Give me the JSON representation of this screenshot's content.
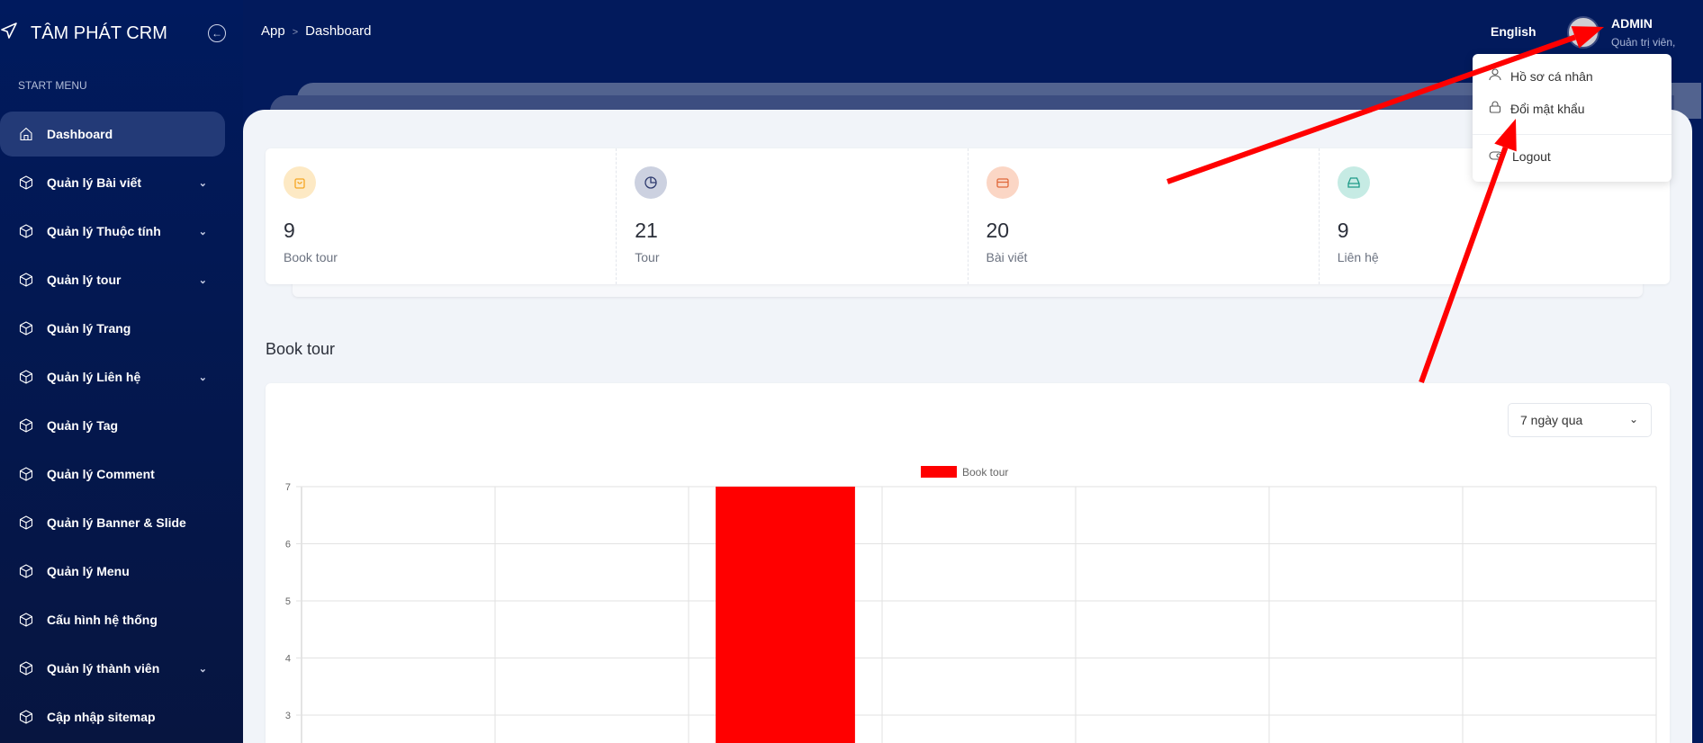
{
  "sidebar": {
    "brand": "TÂM PHÁT CRM",
    "section_label": "START MENU",
    "items": [
      {
        "label": "Dashboard",
        "icon": "home-icon",
        "active": true,
        "expandable": false
      },
      {
        "label": "Quản lý Bài viết",
        "icon": "cube-icon",
        "expandable": true
      },
      {
        "label": "Quản lý Thuộc tính",
        "icon": "cube-icon",
        "expandable": true
      },
      {
        "label": "Quản lý tour",
        "icon": "cube-icon",
        "expandable": true
      },
      {
        "label": "Quản lý Trang",
        "icon": "cube-icon",
        "expandable": false
      },
      {
        "label": "Quản lý Liên hệ",
        "icon": "cube-icon",
        "expandable": true
      },
      {
        "label": "Quản lý Tag",
        "icon": "cube-icon",
        "expandable": false
      },
      {
        "label": "Quản lý Comment",
        "icon": "cube-icon",
        "expandable": false
      },
      {
        "label": "Quản lý Banner & Slide",
        "icon": "cube-icon",
        "expandable": false
      },
      {
        "label": "Quản lý Menu",
        "icon": "cube-icon",
        "expandable": false
      },
      {
        "label": "Cấu hình hệ thống",
        "icon": "cube-icon",
        "expandable": false
      },
      {
        "label": "Quản lý thành viên",
        "icon": "cube-icon",
        "expandable": true
      },
      {
        "label": "Cập nhập sitemap",
        "icon": "cube-icon",
        "expandable": false
      }
    ]
  },
  "header": {
    "breadcrumb": [
      "App",
      "Dashboard"
    ],
    "language": "English",
    "user": {
      "name": "ADMIN",
      "role": "Quản trị viên,"
    }
  },
  "user_menu": {
    "items": [
      {
        "label": "Hồ sơ cá nhân",
        "icon": "user-icon"
      },
      {
        "label": "Đổi mật khẩu",
        "icon": "lock-icon"
      },
      {
        "label": "Logout",
        "icon": "toggle-icon"
      }
    ]
  },
  "stats": [
    {
      "value": "9",
      "label": "Book tour",
      "icon": "shopping-bag-icon",
      "color": "#f5a623",
      "bg": "#fde9c4"
    },
    {
      "value": "21",
      "label": "Tour",
      "icon": "pie-chart-icon",
      "color": "#2d3a6e",
      "bg": "#ccd1e0"
    },
    {
      "value": "20",
      "label": "Bài viết",
      "icon": "credit-card-icon",
      "color": "#e0683a",
      "bg": "#fbd6c5"
    },
    {
      "value": "9",
      "label": "Liên hệ",
      "icon": "inbox-icon",
      "color": "#1e9a87",
      "bg": "#c6ebe4"
    }
  ],
  "section_title": "Book tour",
  "range_select": {
    "value": "7 ngày qua"
  },
  "chart_data": {
    "type": "bar",
    "legend": [
      {
        "name": "Book tour",
        "color": "#ff0000"
      }
    ],
    "legend_position": "top",
    "categories_count": 7,
    "series": [
      {
        "name": "Book tour",
        "values": [
          0,
          0,
          7,
          0,
          0,
          0,
          0
        ]
      }
    ],
    "yticks": [
      3,
      4,
      5,
      6,
      7
    ],
    "ylim": [
      0,
      7
    ],
    "grid": true
  },
  "annotation_color": "#ff0000"
}
